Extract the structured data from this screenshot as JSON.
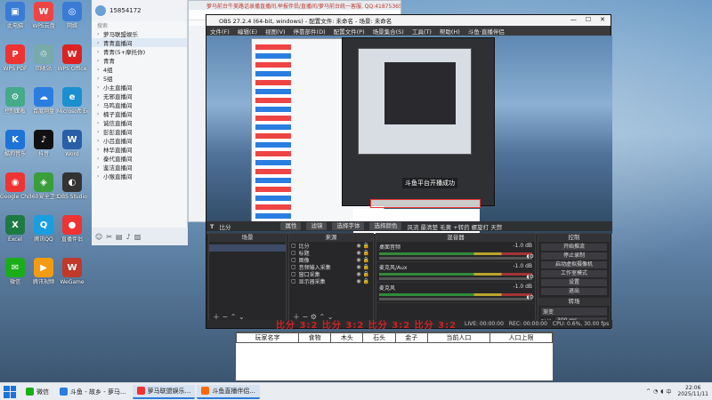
{
  "desktop_icons": [
    {
      "label": "此电脑",
      "color": "#3a7bd5",
      "glyph": "▣"
    },
    {
      "label": "WPS云盘",
      "color": "#e44",
      "glyph": "W"
    },
    {
      "label": "网络",
      "color": "#3a7bd5",
      "glyph": "◎"
    },
    {
      "label": "WPS PDF",
      "color": "#e33",
      "glyph": "P"
    },
    {
      "label": "回收站",
      "color": "#7aa",
      "glyph": "♲"
    },
    {
      "label": "WPS Office",
      "color": "#d22",
      "glyph": "W"
    },
    {
      "label": "控制面板",
      "color": "#4a8",
      "glyph": "⚙"
    },
    {
      "label": "百度网盘",
      "color": "#2a7de1",
      "glyph": "☁"
    },
    {
      "label": "Microsoft Edge",
      "color": "#1c8fd0",
      "glyph": "e"
    },
    {
      "label": "酷狗音乐",
      "color": "#1e73d8",
      "glyph": "K"
    },
    {
      "label": "抖音",
      "color": "#111",
      "glyph": "♪"
    },
    {
      "label": "Word",
      "color": "#2a5ea8",
      "glyph": "W"
    },
    {
      "label": "Google Chrome",
      "color": "#e33",
      "glyph": "◉"
    },
    {
      "label": "360安全卫士",
      "color": "#3a9e3a",
      "glyph": "◈"
    },
    {
      "label": "OBS Studio",
      "color": "#333",
      "glyph": "◐"
    },
    {
      "label": "Excel",
      "color": "#1d7a43",
      "glyph": "X"
    },
    {
      "label": "腾讯QQ",
      "color": "#1a9ee0",
      "glyph": "Q"
    },
    {
      "label": "直播伴侣",
      "color": "#e33",
      "glyph": "●"
    },
    {
      "label": "微信",
      "color": "#1aad19",
      "glyph": "✉"
    },
    {
      "label": "腾讯视频",
      "color": "#f39c12",
      "glyph": "▶"
    },
    {
      "label": "WeGame",
      "color": "#c0392b",
      "glyph": "W"
    }
  ],
  "qq": {
    "number": "15854172",
    "search_placeholder": "搜索",
    "groups": [
      {
        "label": "萝马联盟娱乐",
        "sel": false
      },
      {
        "label": "青青直播间",
        "sel": true
      },
      {
        "label": "青青(5+摩托你)",
        "sel": false
      },
      {
        "label": "青青",
        "sel": false
      },
      {
        "label": "4组",
        "sel": false
      },
      {
        "label": "5组",
        "sel": false
      },
      {
        "label": "小主直播间",
        "sel": false
      },
      {
        "label": "无邪直播间",
        "sel": false
      },
      {
        "label": "马鸣直播间",
        "sel": false
      },
      {
        "label": "楠子直播间",
        "sel": false
      },
      {
        "label": "诚信直播间",
        "sel": false
      },
      {
        "label": "彭彭直播间",
        "sel": false
      },
      {
        "label": "小吕直播间",
        "sel": false
      },
      {
        "label": "林华直播间",
        "sel": false
      },
      {
        "label": "秦代直播间",
        "sel": false
      },
      {
        "label": "鉴洁直播间",
        "sel": false
      },
      {
        "label": "小猴直播间",
        "sel": false
      }
    ]
  },
  "browser": {
    "title": "萝马前台牛美路话录播直播间,举报伴侣/直播间/萝马前台统一客服, QQ:418753651(新增已添加)"
  },
  "obs": {
    "title": "OBS 27.2.4 (64-bit, windows) - 配置文件: 未命名 - 场景: 未命名",
    "menu": [
      "文件(F)",
      "编辑(E)",
      "视图(V)",
      "停靠部件(D)",
      "配置文件(P)",
      "场景集合(S)",
      "工具(T)",
      "帮助(H)",
      "斗鱼·直播伴侣"
    ],
    "preview_text": "斗鱼平台开播成功",
    "source_bar": {
      "label": "比分",
      "btns": [
        "属性",
        "滤镜",
        "选择字体",
        "选择颜色"
      ],
      "extra": "风流 最清楚 毛黄 +转药 螺旋打 天弊"
    },
    "panels": {
      "scenes": "场景",
      "sources": "来源",
      "mixer": "混音器",
      "transitions": "转场",
      "controls": "控制"
    },
    "sources": [
      "比分",
      "标题",
      "图像",
      "音频输入采集",
      "窗口采集",
      "显示器采集"
    ],
    "mixer": [
      {
        "name": "桌面音频",
        "db": "-1.0 dB"
      },
      {
        "name": "麦克风/Aux",
        "db": "-1.0 dB"
      },
      {
        "name": "麦克风",
        "db": "-1.0 dB"
      }
    ],
    "controls": [
      "开始推流",
      "停止录制",
      "启动虚拟摄像机",
      "工作室模式",
      "设置",
      "退出"
    ],
    "transitions": {
      "selected": "渐变",
      "duration_label": "时长",
      "duration": "300 ms"
    },
    "status": [
      "LIVE: 00:00:00",
      "REC: 00:00:00",
      "CPU: 0.6%, 30.00 fps"
    ]
  },
  "overlay_red": "比分 3:2 比分 3:2 比分 3:2 比分 3:2",
  "table": {
    "headers": [
      "玩家名字",
      "食物",
      "木头",
      "石头",
      "金子",
      "当前人口",
      "人口上限"
    ]
  },
  "taskbar": {
    "items": [
      {
        "label": "微信",
        "color": "#1aad19"
      },
      {
        "label": "斗鱼 - 故乡 - 萝马...",
        "color": "#2a7de1"
      },
      {
        "label": "萝马联盟娱乐...",
        "color": "#e33"
      },
      {
        "label": "斗鱼直播伴侣...",
        "color": "#ff6a00"
      }
    ],
    "time": "22:06",
    "date": "2025/11/11",
    "ime": "中"
  },
  "colors": {
    "obs_bg": "#2b2b2e",
    "accent": "#2d7ad6",
    "red": "#e81f1f"
  }
}
